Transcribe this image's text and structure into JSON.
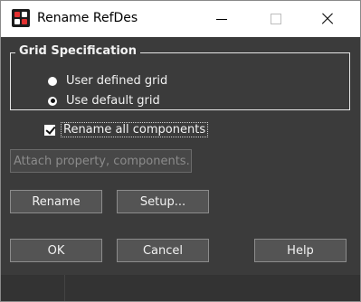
{
  "window": {
    "title": "Rename RefDes",
    "app_icon": "app-logo-icon",
    "controls": [
      "minimize-icon",
      "maximize-icon",
      "close-icon"
    ]
  },
  "grid_spec": {
    "legend": "Grid Specification",
    "options": [
      {
        "label": "User defined grid",
        "selected": false
      },
      {
        "label": "Use default grid",
        "selected": true
      }
    ]
  },
  "rename_all": {
    "label": "Rename all components",
    "checked": true
  },
  "buttons": {
    "attach": "Attach property, components...",
    "rename": "Rename",
    "setup": "Setup...",
    "ok": "OK",
    "cancel": "Cancel",
    "help": "Help"
  },
  "colors": {
    "dialog_bg": "#3b3b3b",
    "titlebar_bg": "#ffffff",
    "button_bg": "#545454",
    "text": "#f2f2f2"
  }
}
